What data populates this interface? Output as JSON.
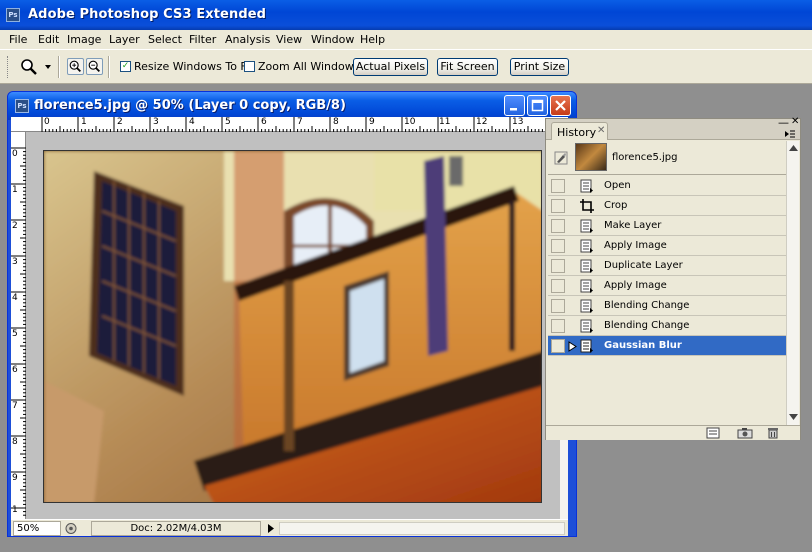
{
  "app": {
    "title": "Adobe Photoshop CS3 Extended",
    "logo": "Ps"
  },
  "menu": [
    "File",
    "Edit",
    "Image",
    "Layer",
    "Select",
    "Filter",
    "Analysis",
    "View",
    "Window",
    "Help"
  ],
  "options": {
    "resize_label": "Resize Windows To Fit",
    "resize_checked": true,
    "zoom_all_label": "Zoom All Windows",
    "zoom_all_checked": false,
    "actual_pixels": "Actual Pixels",
    "fit_screen": "Fit Screen",
    "print_size": "Print Size"
  },
  "document": {
    "title": "florence5.jpg @ 50% (Layer 0 copy, RGB/8)",
    "zoom": "50%",
    "doc_info": "Doc: 2.02M/4.03M",
    "ruler_top": [
      "0",
      "1",
      "2",
      "3",
      "4",
      "5",
      "6",
      "7",
      "8",
      "9",
      "10",
      "11",
      "12",
      "13"
    ],
    "ruler_left": [
      "0",
      "1",
      "2",
      "3",
      "4",
      "5",
      "6",
      "7",
      "8",
      "9",
      "1"
    ]
  },
  "history": {
    "tab": "History",
    "snapshot": "florence5.jpg",
    "items": [
      {
        "label": "Open",
        "icon": "history-state-icon"
      },
      {
        "label": "Crop",
        "icon": "crop-icon"
      },
      {
        "label": "Make Layer",
        "icon": "history-state-icon"
      },
      {
        "label": "Apply Image",
        "icon": "history-state-icon"
      },
      {
        "label": "Duplicate Layer",
        "icon": "history-state-icon"
      },
      {
        "label": "Apply Image",
        "icon": "history-state-icon"
      },
      {
        "label": "Blending Change",
        "icon": "history-state-icon"
      },
      {
        "label": "Blending Change",
        "icon": "history-state-icon"
      },
      {
        "label": "Gaussian Blur",
        "icon": "history-state-icon",
        "selected": true
      }
    ]
  },
  "colors": {
    "xp_blue": "#0a5ee6",
    "selection": "#316ac5",
    "chrome": "#ece9d8"
  }
}
